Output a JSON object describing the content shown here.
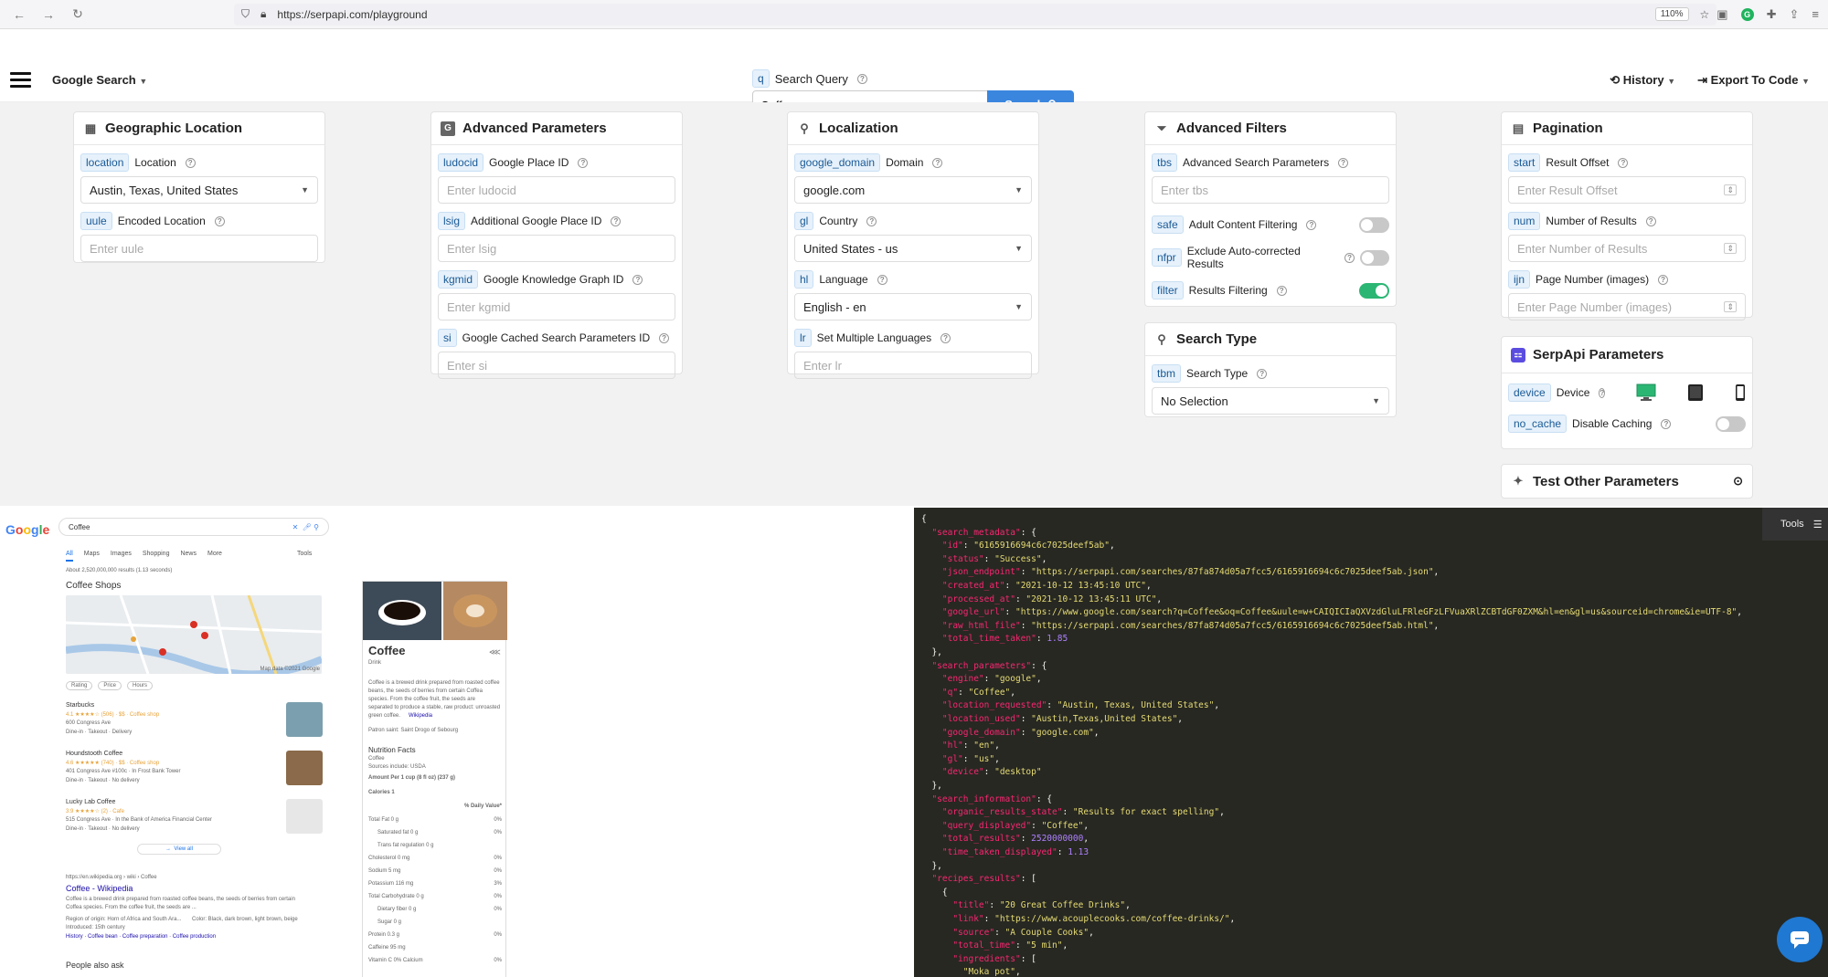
{
  "browser": {
    "url": "https://serpapi.com/playground",
    "zoom": "110%"
  },
  "header": {
    "engine": "Google Search",
    "query_tag": "q",
    "query_label": "Search Query",
    "query_value": "Coffee",
    "search_button": "Search",
    "history": "History",
    "export": "Export To Code"
  },
  "panels": {
    "geo": {
      "title": "Geographic Location",
      "location_tag": "location",
      "location_label": "Location",
      "location_value": "Austin, Texas, United States",
      "uule_tag": "uule",
      "uule_label": "Encoded Location",
      "uule_ph": "Enter uule"
    },
    "adv": {
      "title": "Advanced Parameters",
      "ludocid_tag": "ludocid",
      "ludocid_label": "Google Place ID",
      "ludocid_ph": "Enter ludocid",
      "lsig_tag": "lsig",
      "lsig_label": "Additional Google Place ID",
      "lsig_ph": "Enter lsig",
      "kgmid_tag": "kgmid",
      "kgmid_label": "Google Knowledge Graph ID",
      "kgmid_ph": "Enter kgmid",
      "si_tag": "si",
      "si_label": "Google Cached Search Parameters ID",
      "si_ph": "Enter si"
    },
    "loc": {
      "title": "Localization",
      "domain_tag": "google_domain",
      "domain_label": "Domain",
      "domain_value": "google.com",
      "gl_tag": "gl",
      "gl_label": "Country",
      "gl_value": "United States - us",
      "hl_tag": "hl",
      "hl_label": "Language",
      "hl_value": "English - en",
      "lr_tag": "lr",
      "lr_label": "Set Multiple Languages",
      "lr_ph": "Enter lr"
    },
    "filters": {
      "title": "Advanced Filters",
      "tbs_tag": "tbs",
      "tbs_label": "Advanced Search Parameters",
      "tbs_ph": "Enter tbs",
      "safe_tag": "safe",
      "safe_label": "Adult Content Filtering",
      "nfpr_tag": "nfpr",
      "nfpr_label": "Exclude Auto-corrected Results",
      "filter_tag": "filter",
      "filter_label": "Results Filtering"
    },
    "stype": {
      "title": "Search Type",
      "tbm_tag": "tbm",
      "tbm_label": "Search Type",
      "tbm_value": "No Selection"
    },
    "pag": {
      "title": "Pagination",
      "start_tag": "start",
      "start_label": "Result Offset",
      "start_ph": "Enter Result Offset",
      "num_tag": "num",
      "num_label": "Number of Results",
      "num_ph": "Enter Number of Results",
      "ijn_tag": "ijn",
      "ijn_label": "Page Number (images)",
      "ijn_ph": "Enter Page Number (images)"
    },
    "serp": {
      "title": "SerpApi Parameters",
      "device_tag": "device",
      "device_label": "Device",
      "nocache_tag": "no_cache",
      "nocache_label": "Disable Caching"
    },
    "other": {
      "title": "Test Other Parameters"
    }
  },
  "google": {
    "query": "Coffee",
    "tabs": [
      "All",
      "Maps",
      "Images",
      "Shopping",
      "News",
      "More",
      "Tools"
    ],
    "about": "About 2,520,000,000 results (1.13 seconds)",
    "local_title": "Coffee Shops",
    "map_credit": "Map data ©2021 Google",
    "filters": [
      "Rating",
      "Price",
      "Hours"
    ],
    "places": [
      {
        "name": "Starbucks",
        "meta": "4.1 ★★★★☆ (506) · $$ · Coffee shop",
        "addr": "600 Congress Ave",
        "opts": "Dine-in · Takeout · Delivery"
      },
      {
        "name": "Houndstooth Coffee",
        "meta": "4.6 ★★★★★ (740) · $$ · Coffee shop",
        "addr": "401 Congress Ave #100c · In Frost Bank Tower",
        "opts": "Dine-in · Takeout · No delivery"
      },
      {
        "name": "Lucky Lab Coffee",
        "meta": "3.9 ★★★★☆ (2) · Cafe",
        "addr": "515 Congress Ave · In the Bank of America Financial Center",
        "opts": "Dine-in · Takeout · No delivery"
      }
    ],
    "view_all": "View all",
    "wiki_url": "https://en.wikipedia.org › wiki › Coffee",
    "wiki_title": "Coffee - Wikipedia",
    "wiki_snip1": "Coffee is a brewed drink prepared from roasted coffee beans, the seeds of berries from certain",
    "wiki_snip2": "Coffea species. From the coffee fruit, the seeds are ...",
    "wiki_region": "Region of origin: Horn of Africa and South Ara...",
    "wiki_color": "Color: Black, dark brown, light brown, beige",
    "wiki_intro": "Introduced: 15th century",
    "wiki_links": "History · Coffee bean · Coffee preparation · Coffee production",
    "paa": "People also ask",
    "kp_title": "Coffee",
    "kp_sub": "Drink",
    "kp_desc": [
      "Coffee is a brewed drink prepared from roasted coffee",
      "beans, the seeds of berries from certain Coffea",
      "species. From the coffee fruit, the seeds are",
      "separated to produce a stable, raw product: unroasted",
      "green coffee."
    ],
    "kp_wiki": "Wikipedia",
    "kp_patron": "Patron saint: Saint Drogo of Sebourg",
    "kp_nf": "Nutrition Facts",
    "kp_nf_sub": "Coffee",
    "kp_sources": "Sources include: USDA",
    "kp_amount": "Amount Per 1 cup (8 fl oz) (237 g)",
    "kp_cal": "Calories 1",
    "kp_dv": "% Daily Value*",
    "kp_rows": [
      {
        "label": "Total Fat 0 g",
        "pct": "0%"
      },
      {
        "label": "Saturated fat 0 g",
        "pct": "0%"
      },
      {
        "label": "Trans fat regulation 0 g",
        "pct": ""
      },
      {
        "label": "Cholesterol 0 mg",
        "pct": "0%"
      },
      {
        "label": "Sodium 5 mg",
        "pct": "0%"
      },
      {
        "label": "Potassium 116 mg",
        "pct": "3%"
      },
      {
        "label": "Total Carbohydrate 0 g",
        "pct": "0%"
      },
      {
        "label": "Dietary fiber 0 g",
        "pct": "0%"
      },
      {
        "label": "Sugar 0 g",
        "pct": ""
      },
      {
        "label": "Protein 0.3 g",
        "pct": "0%"
      },
      {
        "label": "Caffeine 95 mg",
        "pct": ""
      },
      {
        "label": "Vitamin C          0%    Calcium",
        "pct": "0%"
      }
    ]
  },
  "json_lines": [
    [
      [
        "p",
        "{"
      ]
    ],
    [
      [
        "p",
        "  "
      ],
      [
        "k",
        "\"search_metadata\""
      ],
      [
        "p",
        ": {"
      ]
    ],
    [
      [
        "p",
        "    "
      ],
      [
        "k",
        "\"id\""
      ],
      [
        "p",
        ": "
      ],
      [
        "s",
        "\"6165916694c6c7025deef5ab\""
      ],
      [
        "p",
        ","
      ]
    ],
    [
      [
        "p",
        "    "
      ],
      [
        "k",
        "\"status\""
      ],
      [
        "p",
        ": "
      ],
      [
        "s",
        "\"Success\""
      ],
      [
        "p",
        ","
      ]
    ],
    [
      [
        "p",
        "    "
      ],
      [
        "k",
        "\"json_endpoint\""
      ],
      [
        "p",
        ": "
      ],
      [
        "s",
        "\"https://serpapi.com/searches/87fa874d05a7fcc5/6165916694c6c7025deef5ab.json\""
      ],
      [
        "p",
        ","
      ]
    ],
    [
      [
        "p",
        "    "
      ],
      [
        "k",
        "\"created_at\""
      ],
      [
        "p",
        ": "
      ],
      [
        "s",
        "\"2021-10-12 13:45:10 UTC\""
      ],
      [
        "p",
        ","
      ]
    ],
    [
      [
        "p",
        "    "
      ],
      [
        "k",
        "\"processed_at\""
      ],
      [
        "p",
        ": "
      ],
      [
        "s",
        "\"2021-10-12 13:45:11 UTC\""
      ],
      [
        "p",
        ","
      ]
    ],
    [
      [
        "p",
        "    "
      ],
      [
        "k",
        "\"google_url\""
      ],
      [
        "p",
        ": "
      ],
      [
        "s",
        "\"https://www.google.com/search?q=Coffee&oq=Coffee&uule=w+CAIQICIaQXVzdGluLFRleGFzLFVuaXRlZCBTdGF0ZXM&hl=en&gl=us&sourceid=chrome&ie=UTF-8\""
      ],
      [
        "p",
        ","
      ]
    ],
    [
      [
        "p",
        "    "
      ],
      [
        "k",
        "\"raw_html_file\""
      ],
      [
        "p",
        ": "
      ],
      [
        "s",
        "\"https://serpapi.com/searches/87fa874d05a7fcc5/6165916694c6c7025deef5ab.html\""
      ],
      [
        "p",
        ","
      ]
    ],
    [
      [
        "p",
        "    "
      ],
      [
        "k",
        "\"total_time_taken\""
      ],
      [
        "p",
        ": "
      ],
      [
        "n",
        "1.85"
      ]
    ],
    [
      [
        "p",
        "  },"
      ]
    ],
    [
      [
        "p",
        "  "
      ],
      [
        "k",
        "\"search_parameters\""
      ],
      [
        "p",
        ": {"
      ]
    ],
    [
      [
        "p",
        "    "
      ],
      [
        "k",
        "\"engine\""
      ],
      [
        "p",
        ": "
      ],
      [
        "s",
        "\"google\""
      ],
      [
        "p",
        ","
      ]
    ],
    [
      [
        "p",
        "    "
      ],
      [
        "k",
        "\"q\""
      ],
      [
        "p",
        ": "
      ],
      [
        "s",
        "\"Coffee\""
      ],
      [
        "p",
        ","
      ]
    ],
    [
      [
        "p",
        "    "
      ],
      [
        "k",
        "\"location_requested\""
      ],
      [
        "p",
        ": "
      ],
      [
        "s",
        "\"Austin, Texas, United States\""
      ],
      [
        "p",
        ","
      ]
    ],
    [
      [
        "p",
        "    "
      ],
      [
        "k",
        "\"location_used\""
      ],
      [
        "p",
        ": "
      ],
      [
        "s",
        "\"Austin,Texas,United States\""
      ],
      [
        "p",
        ","
      ]
    ],
    [
      [
        "p",
        "    "
      ],
      [
        "k",
        "\"google_domain\""
      ],
      [
        "p",
        ": "
      ],
      [
        "s",
        "\"google.com\""
      ],
      [
        "p",
        ","
      ]
    ],
    [
      [
        "p",
        "    "
      ],
      [
        "k",
        "\"hl\""
      ],
      [
        "p",
        ": "
      ],
      [
        "s",
        "\"en\""
      ],
      [
        "p",
        ","
      ]
    ],
    [
      [
        "p",
        "    "
      ],
      [
        "k",
        "\"gl\""
      ],
      [
        "p",
        ": "
      ],
      [
        "s",
        "\"us\""
      ],
      [
        "p",
        ","
      ]
    ],
    [
      [
        "p",
        "    "
      ],
      [
        "k",
        "\"device\""
      ],
      [
        "p",
        ": "
      ],
      [
        "s",
        "\"desktop\""
      ]
    ],
    [
      [
        "p",
        "  },"
      ]
    ],
    [
      [
        "p",
        "  "
      ],
      [
        "k",
        "\"search_information\""
      ],
      [
        "p",
        ": {"
      ]
    ],
    [
      [
        "p",
        "    "
      ],
      [
        "k",
        "\"organic_results_state\""
      ],
      [
        "p",
        ": "
      ],
      [
        "s",
        "\"Results for exact spelling\""
      ],
      [
        "p",
        ","
      ]
    ],
    [
      [
        "p",
        "    "
      ],
      [
        "k",
        "\"query_displayed\""
      ],
      [
        "p",
        ": "
      ],
      [
        "s",
        "\"Coffee\""
      ],
      [
        "p",
        ","
      ]
    ],
    [
      [
        "p",
        "    "
      ],
      [
        "k",
        "\"total_results\""
      ],
      [
        "p",
        ": "
      ],
      [
        "n",
        "2520000000"
      ],
      [
        "p",
        ","
      ]
    ],
    [
      [
        "p",
        "    "
      ],
      [
        "k",
        "\"time_taken_displayed\""
      ],
      [
        "p",
        ": "
      ],
      [
        "n",
        "1.13"
      ]
    ],
    [
      [
        "p",
        "  },"
      ]
    ],
    [
      [
        "p",
        "  "
      ],
      [
        "k",
        "\"recipes_results\""
      ],
      [
        "p",
        ": ["
      ]
    ],
    [
      [
        "p",
        "    {"
      ]
    ],
    [
      [
        "p",
        "      "
      ],
      [
        "k",
        "\"title\""
      ],
      [
        "p",
        ": "
      ],
      [
        "s",
        "\"20 Great Coffee Drinks\""
      ],
      [
        "p",
        ","
      ]
    ],
    [
      [
        "p",
        "      "
      ],
      [
        "k",
        "\"link\""
      ],
      [
        "p",
        ": "
      ],
      [
        "s",
        "\"https://www.acouplecooks.com/coffee-drinks/\""
      ],
      [
        "p",
        ","
      ]
    ],
    [
      [
        "p",
        "      "
      ],
      [
        "k",
        "\"source\""
      ],
      [
        "p",
        ": "
      ],
      [
        "s",
        "\"A Couple Cooks\""
      ],
      [
        "p",
        ","
      ]
    ],
    [
      [
        "p",
        "      "
      ],
      [
        "k",
        "\"total_time\""
      ],
      [
        "p",
        ": "
      ],
      [
        "s",
        "\"5 min\""
      ],
      [
        "p",
        ","
      ]
    ],
    [
      [
        "p",
        "      "
      ],
      [
        "k",
        "\"ingredients\""
      ],
      [
        "p",
        ": ["
      ]
    ],
    [
      [
        "p",
        "        "
      ],
      [
        "s",
        "\"Moka pot\""
      ],
      [
        "p",
        ","
      ]
    ]
  ],
  "json_tools": "Tools"
}
